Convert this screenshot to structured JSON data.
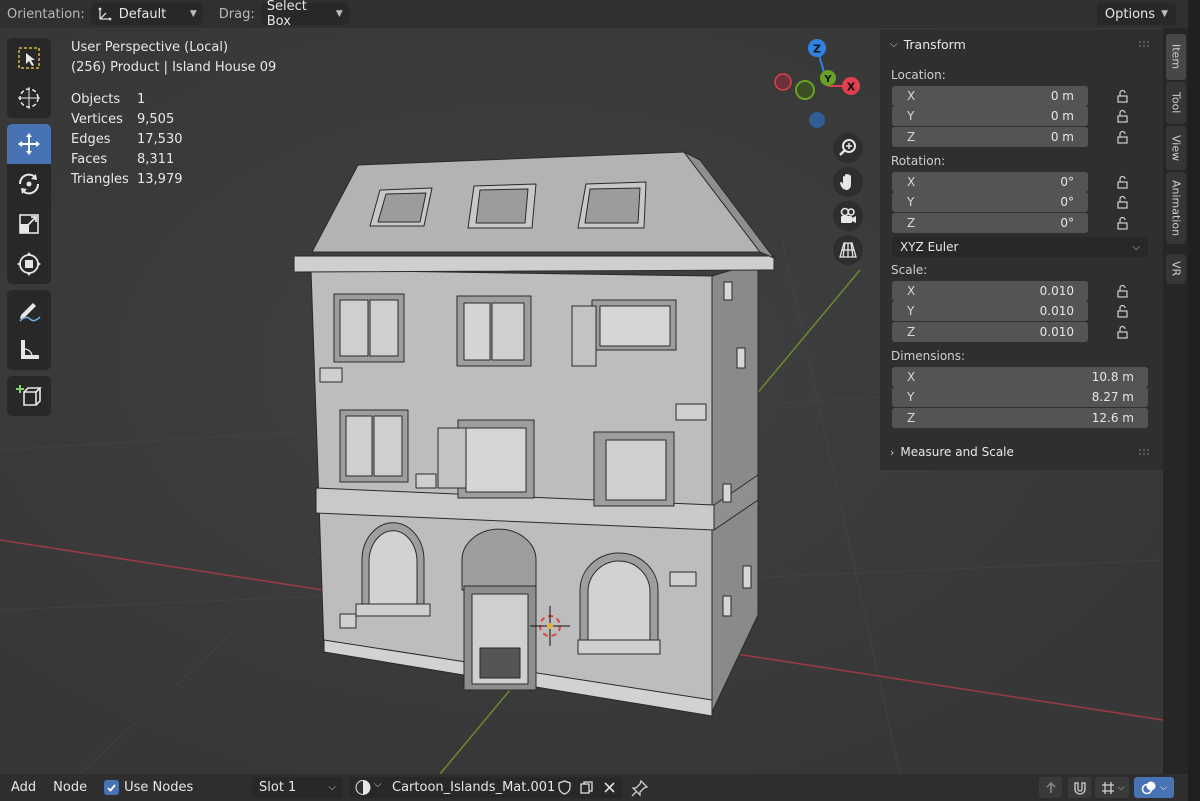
{
  "header": {
    "orientation_label": "Orientation:",
    "orientation_value": "Default",
    "drag_label": "Drag:",
    "drag_value": "Select Box",
    "options_label": "Options"
  },
  "overlay": {
    "view_name": "User Perspective (Local)",
    "object_name": "(256) Product | Island House 09",
    "stats": [
      {
        "label": "Objects",
        "value": "1"
      },
      {
        "label": "Vertices",
        "value": "9,505"
      },
      {
        "label": "Edges",
        "value": "17,530"
      },
      {
        "label": "Faces",
        "value": "8,311"
      },
      {
        "label": "Triangles",
        "value": "13,979"
      }
    ]
  },
  "gizmo": {
    "z": "Z",
    "y": "Y",
    "x": "X"
  },
  "transform": {
    "title": "Transform",
    "location_label": "Location:",
    "location": [
      {
        "axis": "X",
        "value": "0 m"
      },
      {
        "axis": "Y",
        "value": "0 m"
      },
      {
        "axis": "Z",
        "value": "0 m"
      }
    ],
    "rotation_label": "Rotation:",
    "rotation": [
      {
        "axis": "X",
        "value": "0°"
      },
      {
        "axis": "Y",
        "value": "0°"
      },
      {
        "axis": "Z",
        "value": "0°"
      }
    ],
    "rotation_mode": "XYZ Euler",
    "scale_label": "Scale:",
    "scale": [
      {
        "axis": "X",
        "value": "0.010"
      },
      {
        "axis": "Y",
        "value": "0.010"
      },
      {
        "axis": "Z",
        "value": "0.010"
      }
    ],
    "dimensions_label": "Dimensions:",
    "dimensions": [
      {
        "axis": "X",
        "value": "10.8 m"
      },
      {
        "axis": "Y",
        "value": "8.27 m"
      },
      {
        "axis": "Z",
        "value": "12.6 m"
      }
    ],
    "measure_label": "Measure and Scale"
  },
  "tabs": [
    "Item",
    "Tool",
    "View",
    "Animation",
    "VR"
  ],
  "bottom": {
    "add_label": "Add",
    "node_label": "Node",
    "use_nodes_label": "Use Nodes",
    "slot_value": "Slot 1",
    "material_name": "Cartoon_Islands_Mat.001"
  },
  "colors": {
    "accent": "#4772b3",
    "axis_x": "#e0404f",
    "axis_y": "#6aa025",
    "axis_z": "#2f83e3",
    "panel_bg": "#2f2f2f",
    "field_bg": "#545454",
    "viewport_bg": "#3b3b3b"
  }
}
